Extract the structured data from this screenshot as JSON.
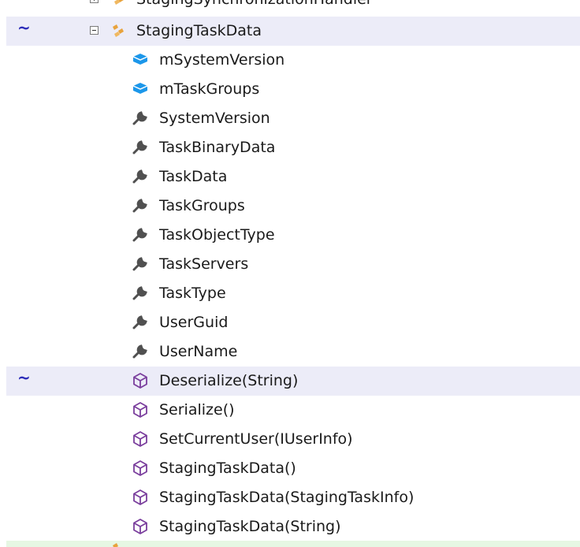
{
  "tree": {
    "change_marker": "~",
    "top_partial": {
      "label": "StagingSynchronizationHandler",
      "icon": "class-icon"
    },
    "parent": {
      "label": "StagingTaskData",
      "icon": "class-icon",
      "expanded": true
    },
    "fields": [
      {
        "label": "mSystemVersion",
        "icon": "field-icon"
      },
      {
        "label": "mTaskGroups",
        "icon": "field-icon"
      }
    ],
    "properties": [
      {
        "label": "SystemVersion",
        "icon": "wrench-icon"
      },
      {
        "label": "TaskBinaryData",
        "icon": "wrench-icon"
      },
      {
        "label": "TaskData",
        "icon": "wrench-icon"
      },
      {
        "label": "TaskGroups",
        "icon": "wrench-icon"
      },
      {
        "label": "TaskObjectType",
        "icon": "wrench-icon"
      },
      {
        "label": "TaskServers",
        "icon": "wrench-icon"
      },
      {
        "label": "TaskType",
        "icon": "wrench-icon"
      },
      {
        "label": "UserGuid",
        "icon": "wrench-icon"
      },
      {
        "label": "UserName",
        "icon": "wrench-icon"
      }
    ],
    "methods": [
      {
        "label": "Deserialize(String)",
        "icon": "method-cube-icon",
        "changed": true
      },
      {
        "label": "Serialize()",
        "icon": "method-cube-icon"
      },
      {
        "label": "SetCurrentUser(IUserInfo)",
        "icon": "method-cube-icon"
      },
      {
        "label": "StagingTaskData()",
        "icon": "method-cube-icon"
      },
      {
        "label": "StagingTaskData(StagingTaskInfo)",
        "icon": "method-cube-icon"
      },
      {
        "label": "StagingTaskData(String)",
        "icon": "method-cube-icon"
      }
    ],
    "colors": {
      "changed_row": "#ececf8",
      "added_row": "#e6f7e3",
      "change_marker": "#2b2bb8",
      "class_icon": "#e8a33d",
      "field_icon": "#1c97ea",
      "wrench_icon": "#505050",
      "method_icon": "#7a3e9d"
    }
  }
}
